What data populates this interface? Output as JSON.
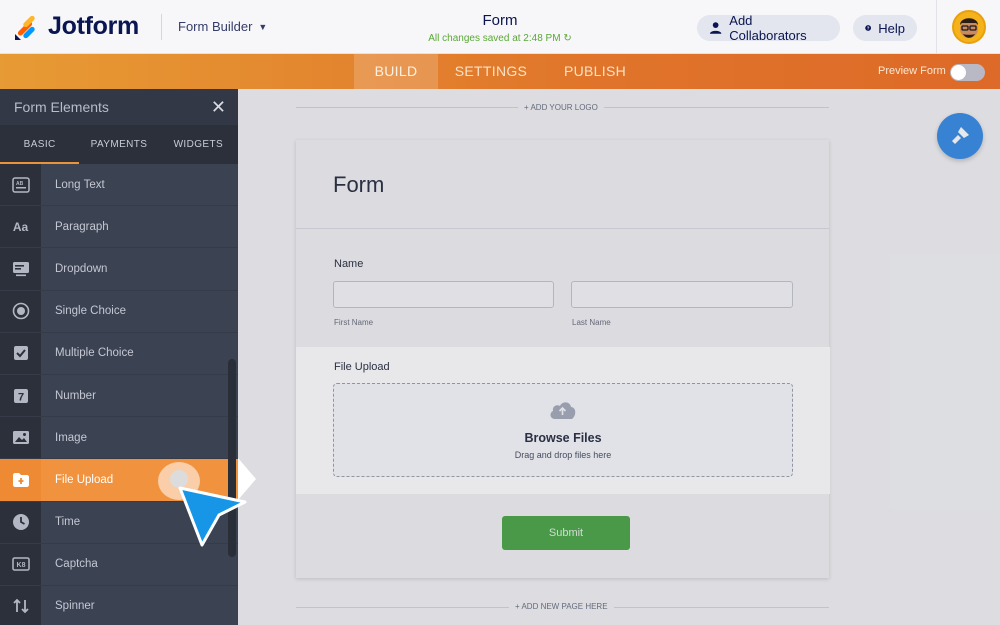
{
  "header": {
    "logo_text": "Jotform",
    "builder_menu_label": "Form Builder",
    "form_title": "Form",
    "save_status": "All changes saved at 2:48 PM",
    "add_collaborators_label": "Add Collaborators",
    "help_label": "Help"
  },
  "nav": {
    "tabs": [
      "BUILD",
      "SETTINGS",
      "PUBLISH"
    ],
    "active_tab": "BUILD",
    "preview_label": "Preview Form",
    "preview_on": false
  },
  "sidebar": {
    "title": "Form Elements",
    "tabs": [
      "BASIC",
      "PAYMENTS",
      "WIDGETS"
    ],
    "active_tab": "BASIC",
    "items": [
      {
        "label": "Long Text",
        "icon": "long-text-icon"
      },
      {
        "label": "Paragraph",
        "icon": "paragraph-icon"
      },
      {
        "label": "Dropdown",
        "icon": "dropdown-icon"
      },
      {
        "label": "Single Choice",
        "icon": "radio-icon"
      },
      {
        "label": "Multiple Choice",
        "icon": "checkbox-icon"
      },
      {
        "label": "Number",
        "icon": "number-icon"
      },
      {
        "label": "Image",
        "icon": "image-icon"
      },
      {
        "label": "File Upload",
        "icon": "file-upload-icon"
      },
      {
        "label": "Time",
        "icon": "clock-icon"
      },
      {
        "label": "Captcha",
        "icon": "captcha-icon"
      },
      {
        "label": "Spinner",
        "icon": "spinner-icon"
      }
    ],
    "selected_item": "File Upload"
  },
  "canvas": {
    "add_logo_label": "+ ADD YOUR LOGO",
    "form_heading": "Form",
    "name_label": "Name",
    "first_name_sublabel": "First Name",
    "last_name_sublabel": "Last Name",
    "file_upload_label": "File Upload",
    "browse_files_label": "Browse Files",
    "drag_drop_hint": "Drag and drop files here",
    "submit_label": "Submit",
    "add_page_label": "+ ADD NEW PAGE HERE"
  },
  "colors": {
    "brand_orange": "#e0742a",
    "sidebar_bg": "#3b4252",
    "selected_item": "#f1923e",
    "submit_green": "#50a84c",
    "fab_blue": "#3a8ee6",
    "save_green": "#5ba837"
  }
}
